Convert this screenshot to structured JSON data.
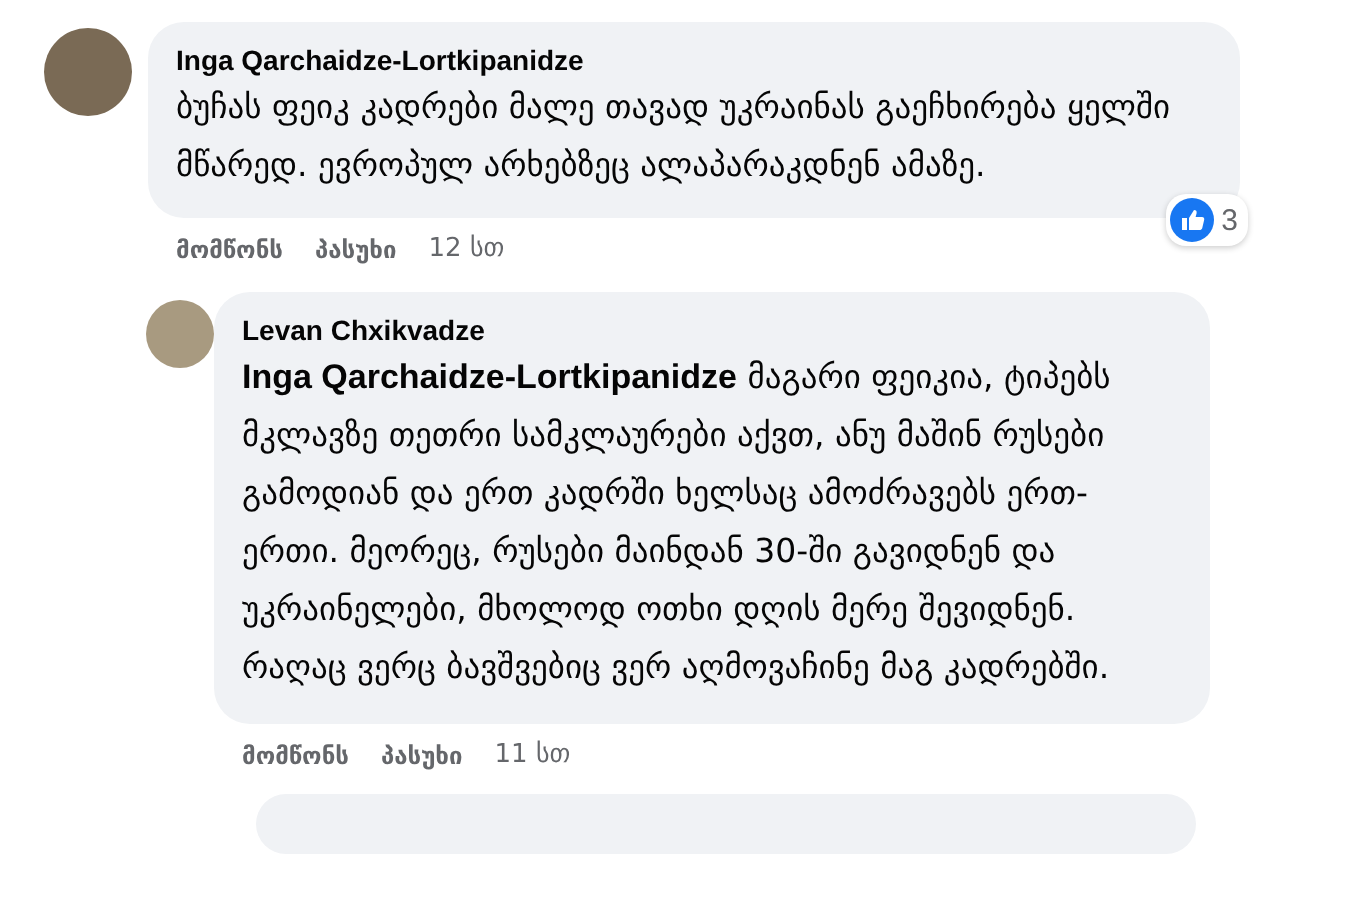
{
  "comments": [
    {
      "author": "Inga Qarchaidze-Lortkipanidze",
      "text": "ბუჩას ფეიკ კადრები მალე თავად უკრაინას გაეჩხირება ყელში მწარედ. ევროპულ არხებზეც ალაპარაკდნენ ამაზე.",
      "reactions": "3",
      "actions": [
        "მომწონს",
        "პასუხი"
      ],
      "time": "12 სთ",
      "replies": [
        {
          "author": "Levan Chxikvadze",
          "text": "**Inga Qarchaidze-Lortkipanidze** მაგარი ფეიკია, ტიპებს მკლავზე თეთრი სამკლაურები აქვთ, ანუ მაშინ რუსები გამოდიან და ერთ კადრში ხელსაც ამოძრავებს ერთ-ერთი. მეორეც, რუსები მაინდან 30-ში გავიდნენ და უკრაინელები, მხოლოდ ოთხი დღის მერე შევიდნენ. რაღაც ვერც ბავშვებიც ვერ აღმოვაჩინე მაგ კადრებში.",
          "actions": [
            "მომწონს",
            "პასუხი"
          ],
          "time": "11 სთ"
        }
      ]
    }
  ]
}
